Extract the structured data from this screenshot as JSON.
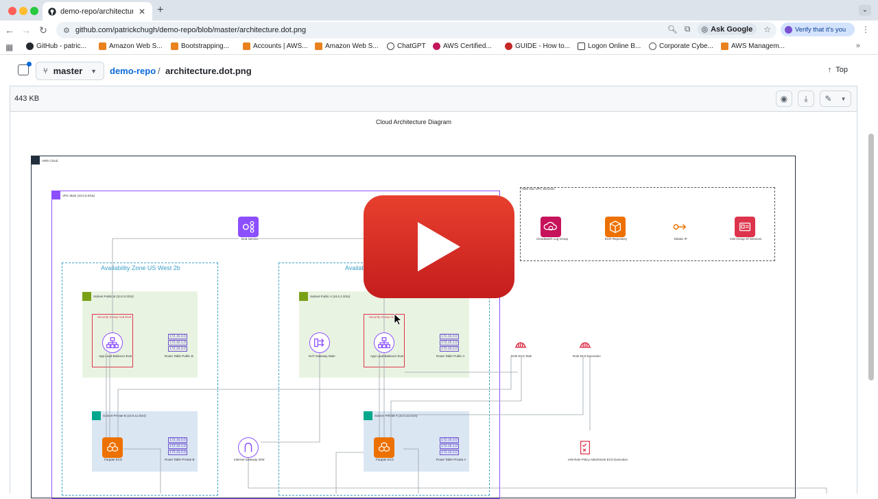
{
  "browser": {
    "tab_title": "demo-repo/architecture.d",
    "url": "github.com/patrickchugh/demo-repo/blob/master/architecture.dot.png",
    "ask_google": "Ask Google",
    "verify": "Verify that it's you",
    "bookmarks": [
      {
        "label": "GitHub - patric...",
        "color": "#24292f"
      },
      {
        "label": "Amazon Web S...",
        "color": "#e8821e"
      },
      {
        "label": "Bootstrapping...",
        "color": "#e8821e"
      },
      {
        "label": "Accounts | AWS...",
        "color": "#e8821e"
      },
      {
        "label": "Amazon Web S...",
        "color": "#e8821e"
      },
      {
        "label": "ChatGPT",
        "color": "#444444"
      },
      {
        "label": "AWS Certified...",
        "color": "#c2185b"
      },
      {
        "label": "GUIDE - How to...",
        "color": "#c62828"
      },
      {
        "label": "Logon Online B...",
        "color": "#333333"
      },
      {
        "label": "Corporate Cybe...",
        "color": "#555555"
      },
      {
        "label": "AWS Managem...",
        "color": "#e8821e"
      }
    ]
  },
  "github": {
    "branch": "master",
    "repo": "demo-repo",
    "separator": "/",
    "file": "architecture.dot.png",
    "top_label": "Top",
    "file_size": "443 KB"
  },
  "diagram": {
    "title": "Cloud Architecture Diagram",
    "aws_cloud_label": "AWS Cloud",
    "vpc_label": "VPC Main (10.0.0.0/16)",
    "group_label": "AWS Non VPC Services",
    "az_b": "Availability Zone US West 2b",
    "az_a": "Availab",
    "elb_service": "ELB Service",
    "cloudwatch": "Cloudwatch Log Group",
    "ecr": "ECR Repository",
    "elastic_ip": "Elastic IP",
    "iam_group": "IAM Group Of Services",
    "subnet_public_b": "Subnet Public B (10.0.2.0/24)",
    "subnet_public_a": "Subnet Public A (10.0.1.0/24)",
    "sg_alb_b": "Security Group ALB ELB",
    "sg_alb_a": "Security Group ALB",
    "alb_b": "App Load Balancer ELB",
    "alb_a": "App Load Balancer ELB",
    "nat": "NAT Gateway Main",
    "rt_public_b": "Route Table Public B",
    "rt_public_a": "Route Table Public A",
    "rt_rows": [
      "172.16.0.0",
      "172.16.1.0",
      "172.16.2.0"
    ],
    "role_task": "Role ECS Task",
    "role_exec": "Role ECS Execution",
    "subnet_private_b": "Subnet Private B (10.0.11.0/24)",
    "subnet_private_a": "Subnet Private A (10.0.10.0/24)",
    "fargate_b": "Fargate ECS",
    "fargate_a": "Fargate ECS",
    "rt_private_b": "Route Table Private B",
    "rt_private_a": "Route Table Private A",
    "igw": "Internet Gateway IGW",
    "iam_policy": "IAM Role Policy Attachment ECS Execution"
  },
  "colors": {
    "github_blue": "#0969da",
    "play_red": "#e8402e",
    "aws_purple": "#8c4fff",
    "aws_orange": "#ed7100",
    "aws_pink": "#c7135b",
    "aws_red": "#dd344c"
  }
}
